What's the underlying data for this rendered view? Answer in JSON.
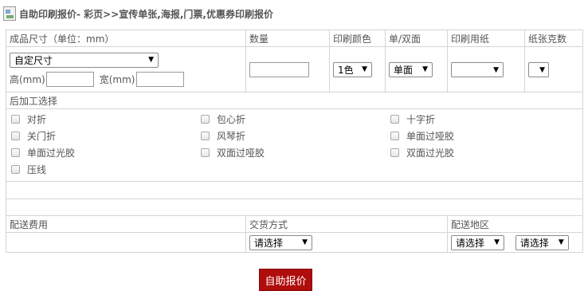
{
  "header": {
    "icon": "broken-image-icon",
    "title": "自助印刷报价- 彩页>>宣传单张,海报,门票,优惠券印刷报价"
  },
  "columns": {
    "size": "成品尺寸（单位：mm）",
    "quantity": "数量",
    "color": "印刷颜色",
    "sides": "单/双面",
    "paper": "印刷用纸",
    "weight": "纸张克数"
  },
  "form": {
    "size_select": "自定尺寸",
    "height_label": "高(mm)",
    "height_value": "",
    "width_label": "宽(mm)",
    "width_value": "",
    "quantity_value": "",
    "color_select": "1色",
    "sides_select": "单面",
    "paper_select": "",
    "weight_select": ""
  },
  "post": {
    "title": "后加工选择",
    "options": [
      "对折",
      "包心折",
      "十字折",
      "关门折",
      "风琴折",
      "单面过哑胶",
      "单面过光胶",
      "双面过哑胶",
      "双面过光胶",
      "压线"
    ]
  },
  "shipping": {
    "fee_label": "配送费用",
    "method_label": "交货方式",
    "area_label": "配送地区",
    "method_select": "请选择",
    "area_select_1": "请选择",
    "area_select_2": "请选择"
  },
  "submit_label": "自助报价",
  "colors": {
    "button": "#b00d0d",
    "border": "#d5d5d5",
    "text": "#555555"
  }
}
